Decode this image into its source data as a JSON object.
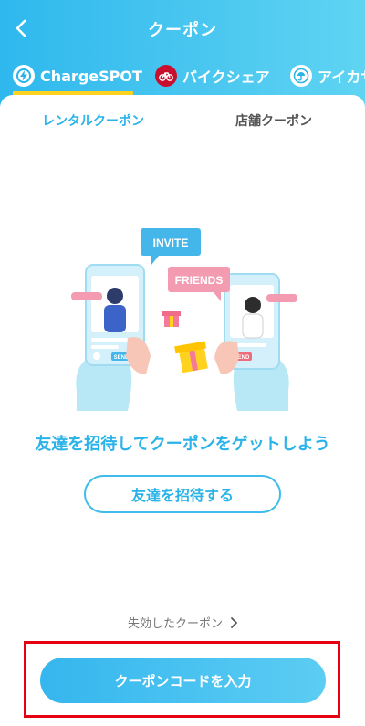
{
  "header": {
    "title": "クーポン"
  },
  "tabs": [
    {
      "label": "ChargeSPOT",
      "icon": "chargespot-icon",
      "active": true
    },
    {
      "label": "バイクシェア",
      "icon": "bicycle-icon",
      "active": false
    },
    {
      "label": "アイカサ",
      "icon": "umbrella-icon",
      "active": false
    }
  ],
  "subtabs": {
    "rental": "レンタルクーポン",
    "store": "店舗クーポン"
  },
  "illustration": {
    "invite_bubble": "INVITE",
    "friends_bubble": "FRIENDS",
    "send_left": "SEND",
    "send_right": "SEND"
  },
  "main": {
    "headline": "友達を招待してクーポンをゲットしよう",
    "invite_button": "友達を招待する",
    "expired_link": "失効したクーポン"
  },
  "footer": {
    "code_button": "クーポンコードを入力"
  },
  "colors": {
    "accent": "#29b3e9",
    "tab_indicator": "#ffd21f",
    "highlight": "#e60012"
  }
}
